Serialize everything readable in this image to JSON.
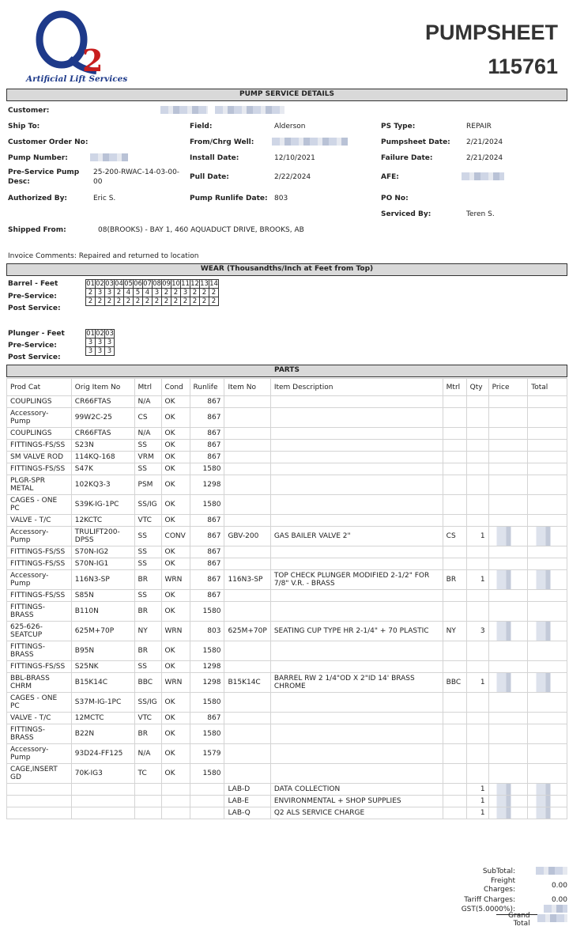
{
  "logo": {
    "mark": "Q2",
    "tagline": "Artificial Lift Services"
  },
  "title": {
    "line1": "PUMPSHEET",
    "line2": "115761"
  },
  "sections": {
    "service": "PUMP SERVICE DETAILS",
    "wear": "WEAR (Thousandths/Inch at Feet from Top)",
    "parts": "PARTS"
  },
  "details": {
    "customer_label": "Customer:",
    "ship_to_label": "Ship To:",
    "field_label": "Field:",
    "field_value": "Alderson",
    "ps_type_label": "PS Type:",
    "ps_type_value": "REPAIR",
    "customer_order_label": "Customer Order No:",
    "from_well_label": "From/Chrg Well:",
    "pumpsheet_date_label": "Pumpsheet Date:",
    "pumpsheet_date_value": "2/21/2024",
    "pump_number_label": "Pump Number:",
    "install_date_label": "Install Date:",
    "install_date_value": "12/10/2021",
    "failure_date_label": "Failure Date:",
    "failure_date_value": "2/21/2024",
    "pre_service_label_1": "Pre-Service Pump",
    "pre_service_label_2": "Desc:",
    "pre_service_value_1": "25-200-RWAC-14-03-00-",
    "pre_service_value_2": "00",
    "pull_date_label": "Pull Date:",
    "pull_date_value": "2/22/2024",
    "afe_label": "AFE:",
    "authorized_label": "Authorized By:",
    "authorized_value": "Eric S.",
    "runlife_label": "Pump Runlife Date:",
    "runlife_value": "803",
    "po_label": "PO No:",
    "serviced_label": "Serviced By:",
    "serviced_value": "Teren S.",
    "shipped_from_label": "Shipped From:",
    "shipped_from_value": "08(BROOKS) - BAY 1, 460 AQUADUCT DRIVE, BROOKS, AB",
    "invoice_comments": "Invoice Comments: Repaired and returned to location"
  },
  "wear": {
    "barrel_label": "Barrel - Feet",
    "barrel_feet": [
      "01",
      "02",
      "03",
      "04",
      "05",
      "06",
      "07",
      "08",
      "09",
      "10",
      "11",
      "12",
      "13",
      "14"
    ],
    "pre_label": "Pre-Service:",
    "barrel_pre": [
      "2",
      "3",
      "3",
      "2",
      "4",
      "5",
      "4",
      "3",
      "2",
      "2",
      "3",
      "2",
      "2",
      "2"
    ],
    "post_label": "Post Service:",
    "barrel_post": [
      "2",
      "2",
      "2",
      "2",
      "2",
      "2",
      "2",
      "2",
      "2",
      "2",
      "2",
      "2",
      "2",
      "2"
    ],
    "plunger_label": "Plunger - Feet",
    "plunger_feet": [
      "01",
      "02",
      "03"
    ],
    "plunger_pre": [
      "3",
      "3",
      "3"
    ],
    "plunger_post": [
      "3",
      "3",
      "3"
    ]
  },
  "parts": {
    "headers": [
      "Prod Cat",
      "Orig Item No",
      "Mtrl",
      "Cond",
      "Runlife",
      "Item No",
      "Item Description",
      "Mtrl",
      "Qty",
      "Price",
      "Total"
    ],
    "rows": [
      [
        "COUPLINGS",
        "CR66FTAS",
        "N/A",
        "OK",
        "867",
        "",
        "",
        "",
        "",
        "",
        ""
      ],
      [
        "Accessory-Pump",
        "99W2C-25",
        "CS",
        "OK",
        "867",
        "",
        "",
        "",
        "",
        "",
        ""
      ],
      [
        "COUPLINGS",
        "CR66FTAS",
        "N/A",
        "OK",
        "867",
        "",
        "",
        "",
        "",
        "",
        ""
      ],
      [
        "FITTINGS-FS/SS",
        "S23N",
        "SS",
        "OK",
        "867",
        "",
        "",
        "",
        "",
        "",
        ""
      ],
      [
        "SM VALVE ROD",
        "114KQ-168",
        "VRM",
        "OK",
        "867",
        "",
        "",
        "",
        "",
        "",
        ""
      ],
      [
        "FITTINGS-FS/SS",
        "S47K",
        "SS",
        "OK",
        "1580",
        "",
        "",
        "",
        "",
        "",
        ""
      ],
      [
        "PLGR-SPR METAL",
        "102KQ3-3",
        "PSM",
        "OK",
        "1298",
        "",
        "",
        "",
        "",
        "",
        ""
      ],
      [
        "CAGES - ONE PC",
        "S39K-IG-1PC",
        "SS/IG",
        "OK",
        "1580",
        "",
        "",
        "",
        "",
        "",
        ""
      ],
      [
        "VALVE - T/C",
        "12KCTC",
        "VTC",
        "OK",
        "867",
        "",
        "",
        "",
        "",
        "",
        ""
      ],
      [
        "Accessory-Pump",
        "TRULIFT200-DPSS",
        "SS",
        "CONV",
        "867",
        "GBV-200",
        "GAS BAILER VALVE 2\"",
        "CS",
        "1",
        "",
        ""
      ],
      [
        "FITTINGS-FS/SS",
        "S70N-IG2",
        "SS",
        "OK",
        "867",
        "",
        "",
        "",
        "",
        "",
        ""
      ],
      [
        "FITTINGS-FS/SS",
        "S70N-IG1",
        "SS",
        "OK",
        "867",
        "",
        "",
        "",
        "",
        "",
        ""
      ],
      [
        "Accessory-Pump",
        "116N3-SP",
        "BR",
        "WRN",
        "867",
        "116N3-SP",
        "TOP CHECK PLUNGER MODIFIED 2-1/2\" FOR 7/8\" V.R. - BRASS",
        "BR",
        "1",
        "",
        ""
      ],
      [
        "FITTINGS-FS/SS",
        "S85N",
        "SS",
        "OK",
        "867",
        "",
        "",
        "",
        "",
        "",
        ""
      ],
      [
        "FITTINGS-BRASS",
        "B110N",
        "BR",
        "OK",
        "1580",
        "",
        "",
        "",
        "",
        "",
        ""
      ],
      [
        "625-626-SEATCUP",
        "625M+70P",
        "NY",
        "WRN",
        "803",
        "625M+70P",
        "SEATING CUP TYPE HR 2-1/4\" + 70 PLASTIC",
        "NY",
        "3",
        "",
        ""
      ],
      [
        "FITTINGS-BRASS",
        "B95N",
        "BR",
        "OK",
        "1580",
        "",
        "",
        "",
        "",
        "",
        ""
      ],
      [
        "FITTINGS-FS/SS",
        "S25NK",
        "SS",
        "OK",
        "1298",
        "",
        "",
        "",
        "",
        "",
        ""
      ],
      [
        "BBL-BRASS CHRM",
        "B15K14C",
        "BBC",
        "WRN",
        "1298",
        "B15K14C",
        "BARREL RW 2 1/4\"OD X 2\"ID 14' BRASS CHROME",
        "BBC",
        "1",
        "",
        ""
      ],
      [
        "CAGES - ONE PC",
        "S37M-IG-1PC",
        "SS/IG",
        "OK",
        "1580",
        "",
        "",
        "",
        "",
        "",
        ""
      ],
      [
        "VALVE - T/C",
        "12MCTC",
        "VTC",
        "OK",
        "867",
        "",
        "",
        "",
        "",
        "",
        ""
      ],
      [
        "FITTINGS-BRASS",
        "B22N",
        "BR",
        "OK",
        "1580",
        "",
        "",
        "",
        "",
        "",
        ""
      ],
      [
        "Accessory-Pump",
        "93D24-FF125",
        "N/A",
        "OK",
        "1579",
        "",
        "",
        "",
        "",
        "",
        ""
      ],
      [
        "CAGE,INSERT GD",
        "70K-IG3",
        "TC",
        "OK",
        "1580",
        "",
        "",
        "",
        "",
        "",
        ""
      ],
      [
        "",
        "",
        "",
        "",
        "",
        "LAB-D",
        "DATA COLLECTION",
        "",
        "1",
        "",
        ""
      ],
      [
        "",
        "",
        "",
        "",
        "",
        "LAB-E",
        "ENVIRONMENTAL + SHOP SUPPLIES",
        "",
        "1",
        "",
        ""
      ],
      [
        "",
        "",
        "",
        "",
        "",
        "LAB-Q",
        "Q2 ALS SERVICE CHARGE",
        "",
        "1",
        "",
        ""
      ]
    ]
  },
  "totals": {
    "subtotal_label": "SubTotal:",
    "freight_label": "Freight Charges:",
    "freight_value": "0.00",
    "tariff_label": "Tariff Charges:",
    "tariff_value": "0.00",
    "gst_label": "GST(5.0000%):",
    "grand_label": "Grand Total"
  }
}
